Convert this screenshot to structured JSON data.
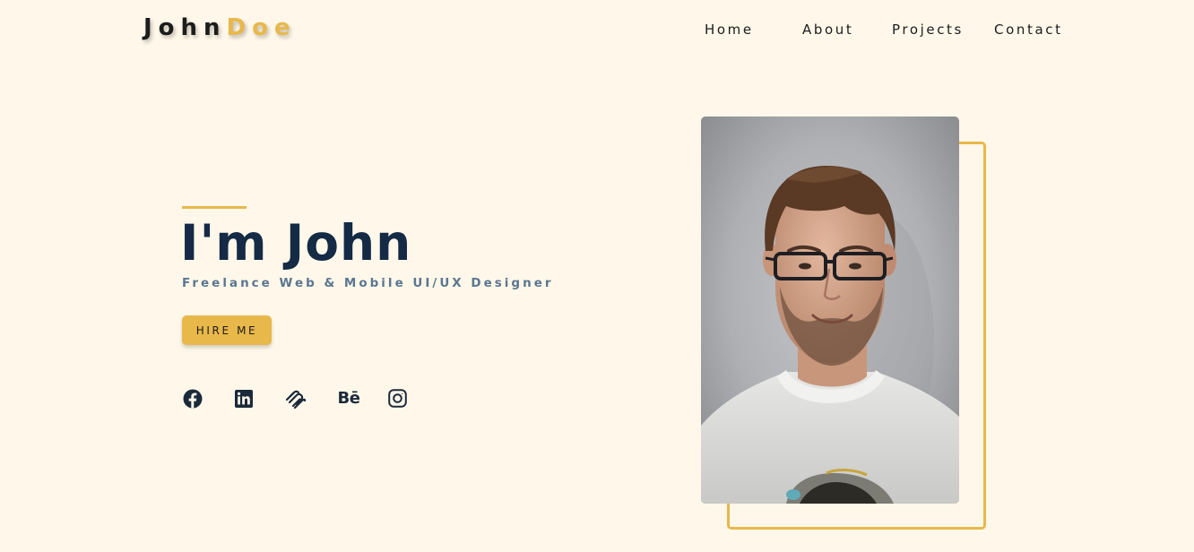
{
  "header": {
    "logo_first": "John",
    "logo_last": "Doe",
    "nav": [
      {
        "label": "Home"
      },
      {
        "label": "About"
      },
      {
        "label": "Projects"
      },
      {
        "label": "Contact"
      }
    ]
  },
  "hero": {
    "title": "I'm John",
    "subtitle": "Freelance Web & Mobile UI/UX Designer",
    "cta_label": "HIRE ME"
  },
  "social": [
    {
      "icon": "facebook-icon"
    },
    {
      "icon": "linkedin-icon"
    },
    {
      "icon": "squarespace-icon"
    },
    {
      "icon": "behance-icon",
      "glyph": "Bē"
    },
    {
      "icon": "instagram-icon"
    }
  ],
  "colors": {
    "background": "#fff8ea",
    "accent": "#e8b84a",
    "title": "#142a45",
    "subtitle": "#5b7690",
    "text": "#1c1c1c"
  }
}
